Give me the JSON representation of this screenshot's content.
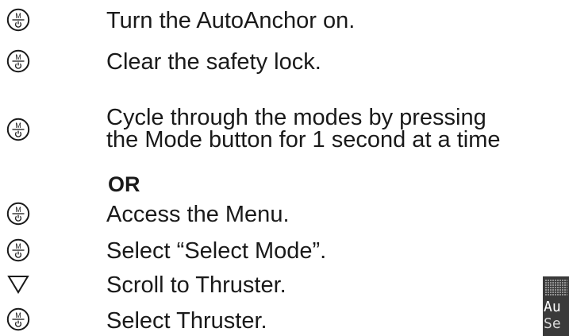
{
  "steps": [
    {
      "icon": "mode-power-button-icon",
      "text": "Turn the AutoAnchor on."
    },
    {
      "icon": "mode-power-button-icon",
      "text": "Clear the safety lock."
    },
    {
      "icon": "mode-power-button-icon",
      "text_line1": "Cycle through the modes by pressing",
      "text_line2": "the Mode button for 1 second at a time"
    },
    {
      "icon": "mode-power-button-icon",
      "text": "Access the Menu."
    },
    {
      "icon": "mode-power-button-icon",
      "text": "Select “Select Mode”."
    },
    {
      "icon": "down-triangle-icon",
      "text": "Scroll to Thruster."
    },
    {
      "icon": "mode-power-button-icon",
      "text": "Select Thruster."
    }
  ],
  "or_label": "OR",
  "button_icon_letter": "M",
  "lcd": {
    "line1": "Au",
    "line2": "Se"
  }
}
